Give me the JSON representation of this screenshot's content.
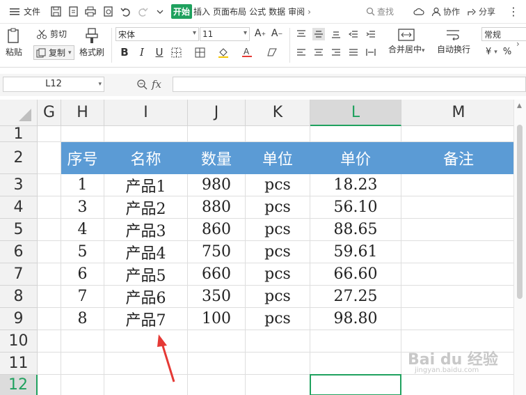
{
  "menu": {
    "file_label": "文件",
    "tabs": [
      "开始",
      "插入",
      "页面布局",
      "公式",
      "数据",
      "审阅"
    ],
    "active_tab": "开始",
    "search_label": "查找",
    "collab_label": "协作",
    "share_label": "分享"
  },
  "ribbon": {
    "paste_label": "粘贴",
    "cut_label": "剪切",
    "copy_label": "复制",
    "format_painter_label": "格式刷",
    "font_name": "宋体",
    "font_size": "11",
    "bold": "B",
    "italic": "I",
    "underline": "U",
    "merge_label": "合并居中",
    "wrap_label": "自动换行",
    "number_format": "常规",
    "currency_symbol": "¥",
    "percent_symbol": "%"
  },
  "formula_bar": {
    "cell_ref": "L12",
    "fx_label": "fx",
    "value": ""
  },
  "sheet": {
    "columns": [
      "G",
      "H",
      "I",
      "J",
      "K",
      "L",
      "M"
    ],
    "selected_column": "L",
    "rows": [
      "1",
      "2",
      "3",
      "4",
      "5",
      "6",
      "7",
      "8",
      "9",
      "10",
      "11",
      "12"
    ],
    "selected_row": "12",
    "selected_cell": "L12",
    "table_header": [
      "序号",
      "名称",
      "数量",
      "单位",
      "单价",
      "备注"
    ],
    "table_rows": [
      [
        "1",
        "产品1",
        "980",
        "pcs",
        "18.23",
        ""
      ],
      [
        "3",
        "产品2",
        "880",
        "pcs",
        "56.10",
        ""
      ],
      [
        "4",
        "产品3",
        "860",
        "pcs",
        "88.65",
        ""
      ],
      [
        "5",
        "产品4",
        "750",
        "pcs",
        "59.61",
        ""
      ],
      [
        "6",
        "产品5",
        "660",
        "pcs",
        "66.60",
        ""
      ],
      [
        "7",
        "产品6",
        "350",
        "pcs",
        "27.25",
        ""
      ],
      [
        "8",
        "产品7",
        "100",
        "pcs",
        "98.80",
        ""
      ]
    ],
    "header_color": "#5b9bd5",
    "accent_color": "#1fa15e",
    "annotation_arrow_color": "#e53935"
  },
  "watermark": {
    "text": "Bai du 经验",
    "subtext": "jingyan.baidu.com"
  }
}
